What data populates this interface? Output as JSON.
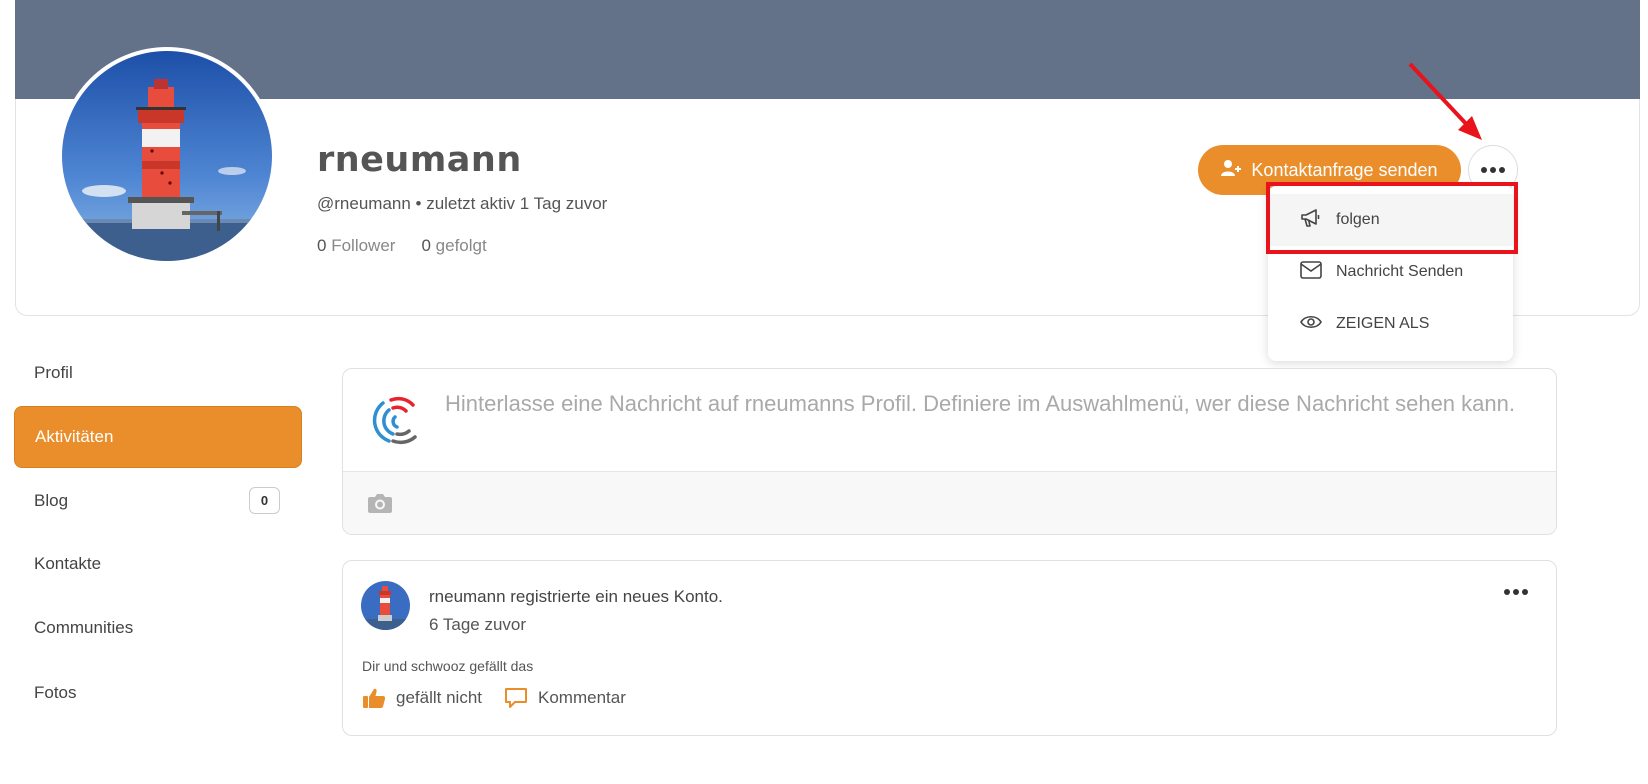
{
  "profile": {
    "username": "rneumann",
    "meta": "@rneumann • zuletzt aktiv 1 Tag zuvor",
    "followers_count": "0",
    "followers_label": "Follower",
    "following_count": "0",
    "following_label": "gefolgt"
  },
  "actions": {
    "contact_request": "Kontaktanfrage senden"
  },
  "dropdown": {
    "items": [
      {
        "label": "folgen",
        "icon": "megaphone-icon"
      },
      {
        "label": "Nachricht Senden",
        "icon": "envelope-icon"
      },
      {
        "label": "ZEIGEN ALS",
        "icon": "eye-icon"
      }
    ]
  },
  "sidebar": {
    "items": [
      {
        "label": "Profil"
      },
      {
        "label": "Aktivitäten",
        "active": true
      },
      {
        "label": "Blog",
        "badge": "0"
      },
      {
        "label": "Kontakte"
      },
      {
        "label": "Communities"
      },
      {
        "label": "Fotos"
      }
    ]
  },
  "composer": {
    "placeholder": "Hinterlasse eine Nachricht auf rneumanns Profil. Definiere im Auswahlmenü, wer diese Nachricht sehen kann."
  },
  "activity": {
    "text": "rneumann registrierte ein neues Konto.",
    "time": "6 Tage zuvor",
    "likes": "Dir und schwooz gefällt das",
    "unlike_label": "gefällt nicht",
    "comment_label": "Kommentar"
  },
  "colors": {
    "accent": "#ea8e2b",
    "cover": "#637189",
    "highlight": "#e8131b"
  }
}
